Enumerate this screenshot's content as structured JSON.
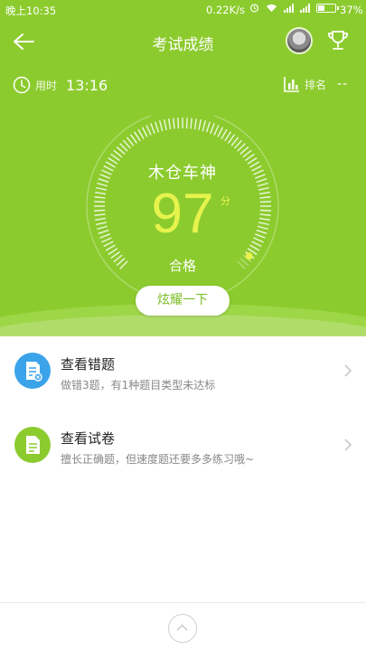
{
  "status_bar": {
    "time": "晚上10:35",
    "network_speed": "0.22K/s",
    "battery": "37%",
    "battery_level": 0.37,
    "icons": [
      "alarm-icon",
      "wifi-icon",
      "signal-icon",
      "signal-icon",
      "battery-icon"
    ]
  },
  "header": {
    "title": "考试成绩",
    "back_icon": "arrow-left-icon",
    "avatar": "user-avatar",
    "trophy_icon": "trophy-icon"
  },
  "stats": {
    "time_label": "用时",
    "time_value": "13:16",
    "rank_label": "排名",
    "rank_value": "--"
  },
  "result": {
    "rank_title": "木仓车神",
    "score": "97",
    "score_unit": "分",
    "score_fraction": 0.97,
    "status": "合格",
    "share_button": "炫耀一下"
  },
  "list": [
    {
      "icon": "document-error-icon",
      "icon_color": "#3ba3ea",
      "title": "查看错题",
      "subtitle": "做错3题，有1种题目类型未达标"
    },
    {
      "icon": "document-icon",
      "icon_color": "#8ccb2e",
      "title": "查看试卷",
      "subtitle": "擅长正确题，但速度题还要多多练习哦~"
    }
  ],
  "bottom": {
    "icon": "chevron-up-icon"
  },
  "colors": {
    "primary": "#8ccb2e",
    "score": "#e6f34d",
    "blue": "#3ba3ea"
  }
}
